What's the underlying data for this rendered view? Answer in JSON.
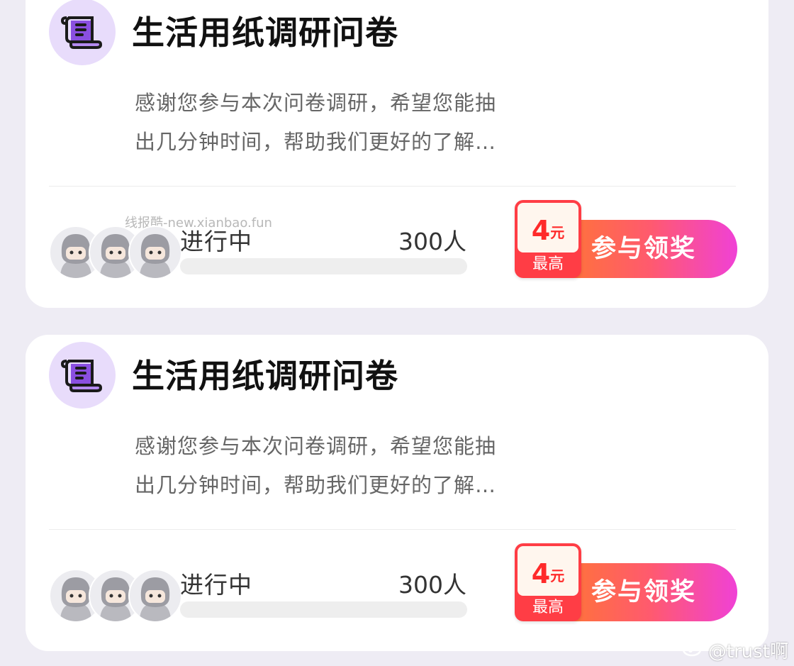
{
  "surveys": [
    {
      "title": "生活用纸调研问卷",
      "description_line1": "感谢您参与本次问卷调研，希望您能抽",
      "description_line2": "出几分钟时间，帮助我们更好的了解…",
      "status": "进行中",
      "participants": "300人",
      "progress_percent": 0,
      "reward_amount": "4",
      "reward_unit": "元",
      "reward_caption": "最高",
      "cta_label": "参与领奖",
      "icon": "scroll-icon"
    },
    {
      "title": "生活用纸调研问卷",
      "description_line1": "感谢您参与本次问卷调研，希望您能抽",
      "description_line2": "出几分钟时间，帮助我们更好的了解…",
      "status": "进行中",
      "participants": "300人",
      "progress_percent": 0,
      "reward_amount": "4",
      "reward_unit": "元",
      "reward_caption": "最高",
      "cta_label": "参与领奖",
      "icon": "scroll-icon"
    }
  ],
  "watermark": "线报酷-new.xianbao.fun",
  "weibo_handle": "@trust啊",
  "colors": {
    "background": "#eeecf4",
    "card": "#ffffff",
    "icon_bg": "#e8dcfb",
    "icon_fg": "#7a3fd0",
    "cta_start": "#ff7a2a",
    "cta_end": "#f041d6",
    "reward_red": "#ff3d45"
  }
}
